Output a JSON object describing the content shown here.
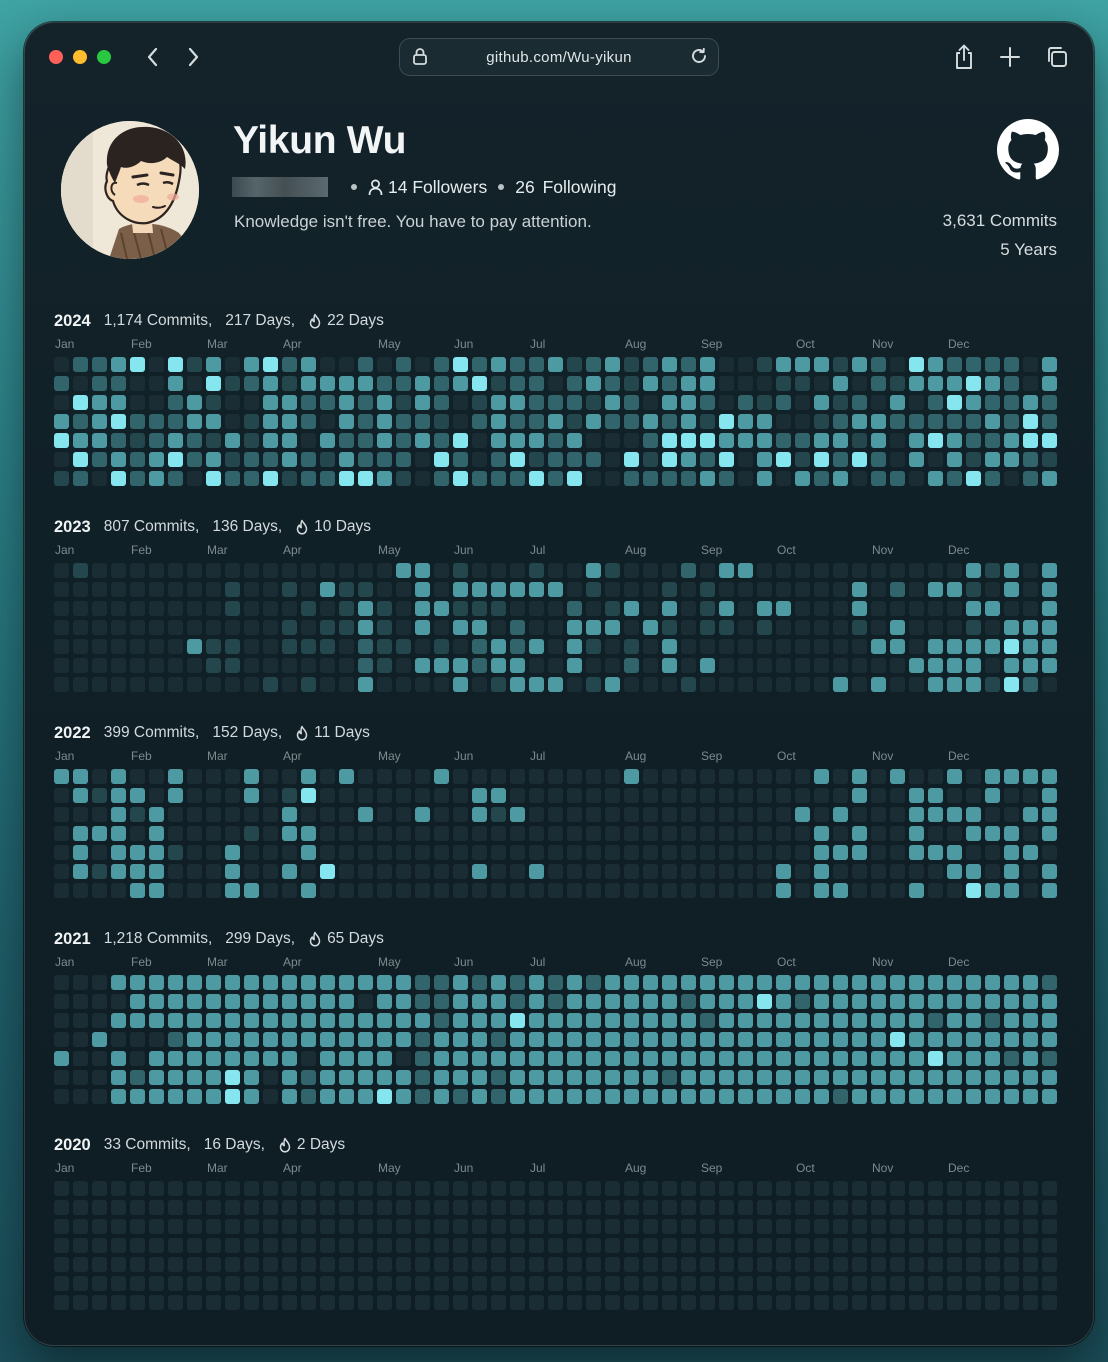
{
  "browser": {
    "url": "github.com/Wu-yikun"
  },
  "profile": {
    "name": "Yikun Wu",
    "followers_count": "14",
    "followers_label": "Followers",
    "following_count": "26",
    "following_label": "Following",
    "bio": "Knowledge isn't free. You have to pay attention.",
    "total_commits": "3,631 Commits",
    "total_years": "5 Years"
  },
  "colors": {
    "level0": "#1b2d34",
    "level1": "#24464d",
    "level2": "#31646b",
    "level3": "#4e9aa2",
    "level4": "#86e6f0"
  },
  "months": [
    "Jan",
    "Feb",
    "Mar",
    "Apr",
    "May",
    "Jun",
    "Jul",
    "Aug",
    "Sep",
    "Oct",
    "Nov",
    "Dec"
  ],
  "years": [
    {
      "year": "2024",
      "commits": "1,174 Commits,",
      "days": "217 Days,",
      "streak": "22 Days",
      "month_labels": [
        "Jan",
        "Feb",
        "Mar",
        "Apr",
        "May",
        "Jun",
        "Jul",
        "Aug",
        "Sep",
        "Oct",
        "Nov",
        "Dec"
      ],
      "month_weeks": [
        0,
        4,
        8,
        12,
        17,
        21,
        25,
        30,
        34,
        39,
        43,
        47
      ],
      "activity": "0203401204234222333203234234400212200022334322342103322034131340100312320112243333242133331332202203203120333234232222402333232212221033230022212424300424241200231333222232342222231430232221221324231302032320001122042230321232324422333432332142300043420023300101333331202403100213303134213123233023140220332201320024302330332240323423322432214232323222223300034422332241332243033412332303422121023233213242210214322330001330322302331330243233333332343323231"
    },
    {
      "year": "2023",
      "commits": "807 Commits,",
      "days": "136 Days,",
      "streak": "10 Days",
      "month_labels": [
        "Jan",
        "Feb",
        "Mar",
        "Apr",
        "May",
        "Jun",
        "Jul",
        "Aug",
        "Sep",
        "Oct",
        "Nov",
        "Dec"
      ],
      "month_weeks": [
        0,
        4,
        8,
        12,
        17,
        21,
        25,
        30,
        34,
        38,
        43,
        47
      ],
      "activity": "0000000100000000000000000000000000000000000000000000030000001100110110000000000000010101100001010103011000111000013322300111103000100333303000301301313033031322003103310302233130030303000030023330310310110130030030120000300001313302000001011103030310003000000003100000300000000000000000000000030331000000030302033000000030030033303003333131333103030133034340003332333333031033333303300333333033033001010300310100301330130003330003033033300110003013303000030010000300300000000000003000000333000"
    },
    {
      "year": "2022",
      "commits": "399 Commits,",
      "days": "152 Days,",
      "streak": "11 Days",
      "month_labels": [
        "Jan",
        "Feb",
        "Mar",
        "Apr",
        "May",
        "Jun",
        "Jul",
        "Aug",
        "Sep",
        "Oct",
        "Nov",
        "Dec"
      ],
      "month_weeks": [
        0,
        4,
        8,
        12,
        17,
        21,
        25,
        30,
        34,
        38,
        43,
        47
      ],
      "activity": "30000003303330010301033333300310333003333333001000000000000000000003333301003000000001330303403303000004030000000030000000000000000000030000300000000000000330030031000000300000000030000000000000000000000000000030000000000000000000000000000000000000000000000000000000000003300300003003333003030333033000000000300000003333030330300303033000330343303003300333330303003333033003333000303030133033433003030"
    },
    {
      "year": "2021",
      "commits": "1,218 Commits,",
      "days": "299 Days,",
      "streak": "65 Days",
      "month_labels": [
        "Jan",
        "Feb",
        "Mar",
        "Apr",
        "May",
        "Jun",
        "Jul",
        "Aug",
        "Sep",
        "Oct",
        "Nov",
        "Dec"
      ],
      "month_weeks": [
        0,
        4,
        8,
        12,
        17,
        21,
        25,
        30,
        34,
        38,
        43,
        47
      ],
      "activity": "000030000000000003000303033333300233330333333233333333333333333333334433333333333300333333333330223333333333333330333333333334333303322322222223333333333223333333332322224333333333332233333333333323333333333333333333333333333333323323333333233333333333333333334333333333333323333333333333333332333333333333333334333333333333234333333333333333333233333333233333333323332332333343333333333333332333333333333333233323332333333333333333333333323333333333033333033033333333333333433333333434333333333333333"
    },
    {
      "year": "2020",
      "commits": "33 Commits,",
      "days": "16 Days,",
      "streak": "2 Days",
      "month_labels": [
        "Jan",
        "Feb",
        "Mar",
        "Apr",
        "May",
        "Jun",
        "Jul",
        "Aug",
        "Sep",
        "Oct",
        "Nov",
        "Dec"
      ],
      "month_weeks": [
        0,
        4,
        8,
        12,
        17,
        21,
        25,
        30,
        34,
        39,
        43,
        47
      ],
      "activity": "0000000000000000000000000000000000000000000000000000000000000000000000000000000000000000000000000000000000000000000000000000000000000000000000000000000000000000000000000000000000000000000000000000000000000000000000000000000000000000000000000000000000000000000000000000000000000000000000000000000000000000000000000000000000000000000000000000000000000000000000000000000000000000000000000000000000000000000000000000000000000000000000000000000000000000000000000000000000000000000000000000000"
    }
  ]
}
